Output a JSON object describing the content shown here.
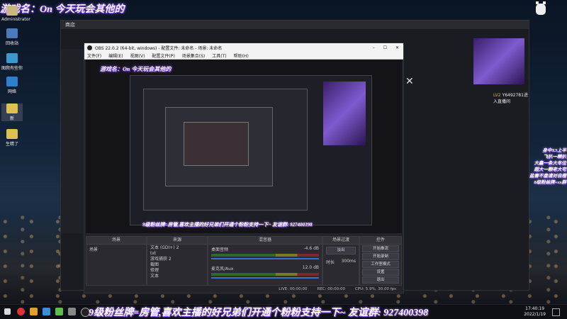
{
  "overlay": {
    "title": "游戏名：On  今天玩会其他的"
  },
  "desktop": {
    "user": "Administrator",
    "icons": [
      "回收站",
      "图爬有些你",
      "网络",
      "新",
      "生精了"
    ]
  },
  "browser": {
    "title": "商店"
  },
  "obs": {
    "title": "OBS 22.0.2 (64-bit, windows) - 配置文件: 未命名 - 场景: 未命名",
    "menu": [
      "文件(F)",
      "编辑(E)",
      "视图(V)",
      "配置文件(P)",
      "场景集合(S)",
      "工具(T)",
      "帮助(H)"
    ],
    "panels": {
      "scenes": "场景",
      "sources": "来源",
      "mixer": "混音器",
      "transitions": "场景过渡",
      "controls": "控件"
    },
    "scenes": [
      "场景"
    ],
    "sources": [
      "文本 (GDI+) 2",
      "txt",
      "游戏捕获 2",
      "截图",
      "修理",
      "文本"
    ],
    "mixer": [
      {
        "name": "桌面音频",
        "db": "-4.6 dB"
      },
      {
        "name": "麦克风/Aux",
        "db": "12.0 dB"
      }
    ],
    "transition": {
      "label": "淡出",
      "duration_label": "时长",
      "duration": "300ms"
    },
    "controls": [
      "开始推流",
      "开始录制",
      "工作室模式",
      "设置",
      "退出"
    ],
    "status": {
      "live": "LIVE: 00:00:00",
      "rec": "REC: 00:00:00",
      "cpu": "CPU: 5.9%, 30.00 fps"
    }
  },
  "stream_overlay": {
    "scroll_text": "9级粉丝牌=房管,喜欢主播的好兄弟们开通个粉粉支持一下~ 友谊群: 927400398",
    "join_msg": "Y6492781进入直播间",
    "level": "LV2",
    "right_text": [
      "身中X3上半",
      "飞扒一瞬扒",
      "大鑫一条大车位",
      "超大一颗老大宅",
      "盐害不盘请对自橙",
      "8级粉丝牌+vx群"
    ]
  },
  "taskbar": {
    "time": "17:40:19",
    "date": "2022/1/19"
  }
}
